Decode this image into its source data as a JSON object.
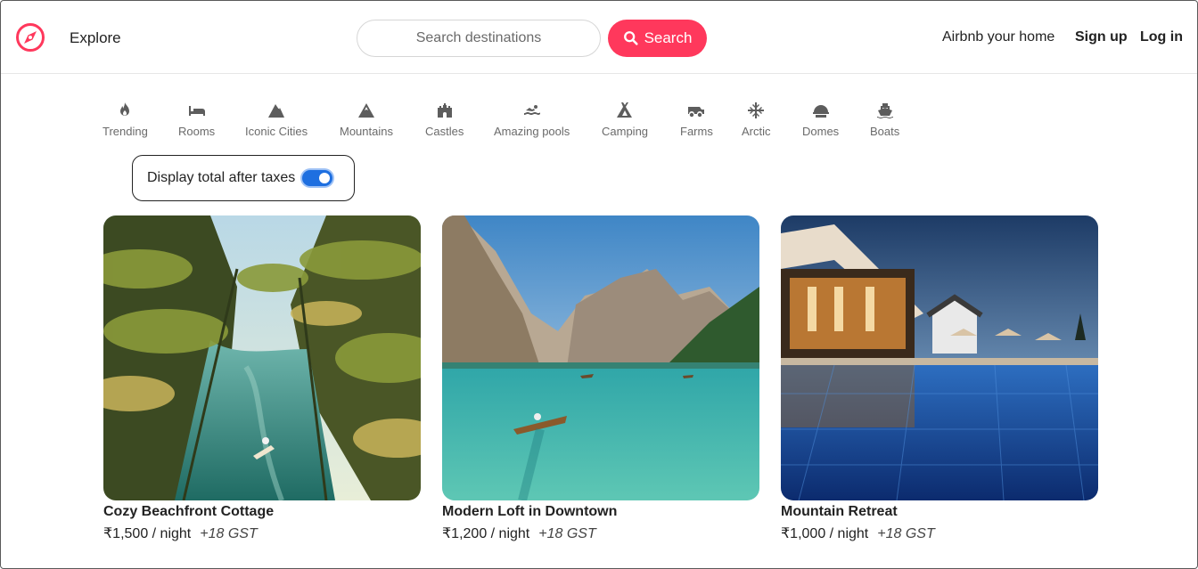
{
  "header": {
    "explore_label": "Explore",
    "search_placeholder": "Search destinations",
    "search_button_label": "Search",
    "host_link": "Airbnb your home",
    "signup_label": "Sign up",
    "login_label": "Log in",
    "brand_color": "#ff385c"
  },
  "categories": [
    {
      "label": "Trending",
      "icon": "fire-icon"
    },
    {
      "label": "Rooms",
      "icon": "bed-icon"
    },
    {
      "label": "Iconic Cities",
      "icon": "city-icon"
    },
    {
      "label": "Mountains",
      "icon": "mountain-icon"
    },
    {
      "label": "Castles",
      "icon": "castle-icon"
    },
    {
      "label": "Amazing pools",
      "icon": "swimmer-icon"
    },
    {
      "label": "Camping",
      "icon": "tent-icon"
    },
    {
      "label": "Farms",
      "icon": "tractor-icon"
    },
    {
      "label": "Arctic",
      "icon": "snowflake-icon"
    },
    {
      "label": "Domes",
      "icon": "dome-icon"
    },
    {
      "label": "Boats",
      "icon": "ship-icon"
    }
  ],
  "tax_toggle": {
    "label": "Display total after taxes",
    "enabled": true,
    "accent": "#1e6fe0"
  },
  "listings": [
    {
      "title": "Cozy Beachfront Cottage",
      "price": "₹1,500 / night",
      "gst": "+18 GST"
    },
    {
      "title": "Modern Loft in Downtown",
      "price": "₹1,200 / night",
      "gst": "+18 GST"
    },
    {
      "title": "Mountain Retreat",
      "price": "₹1,000 / night",
      "gst": "+18 GST"
    }
  ]
}
